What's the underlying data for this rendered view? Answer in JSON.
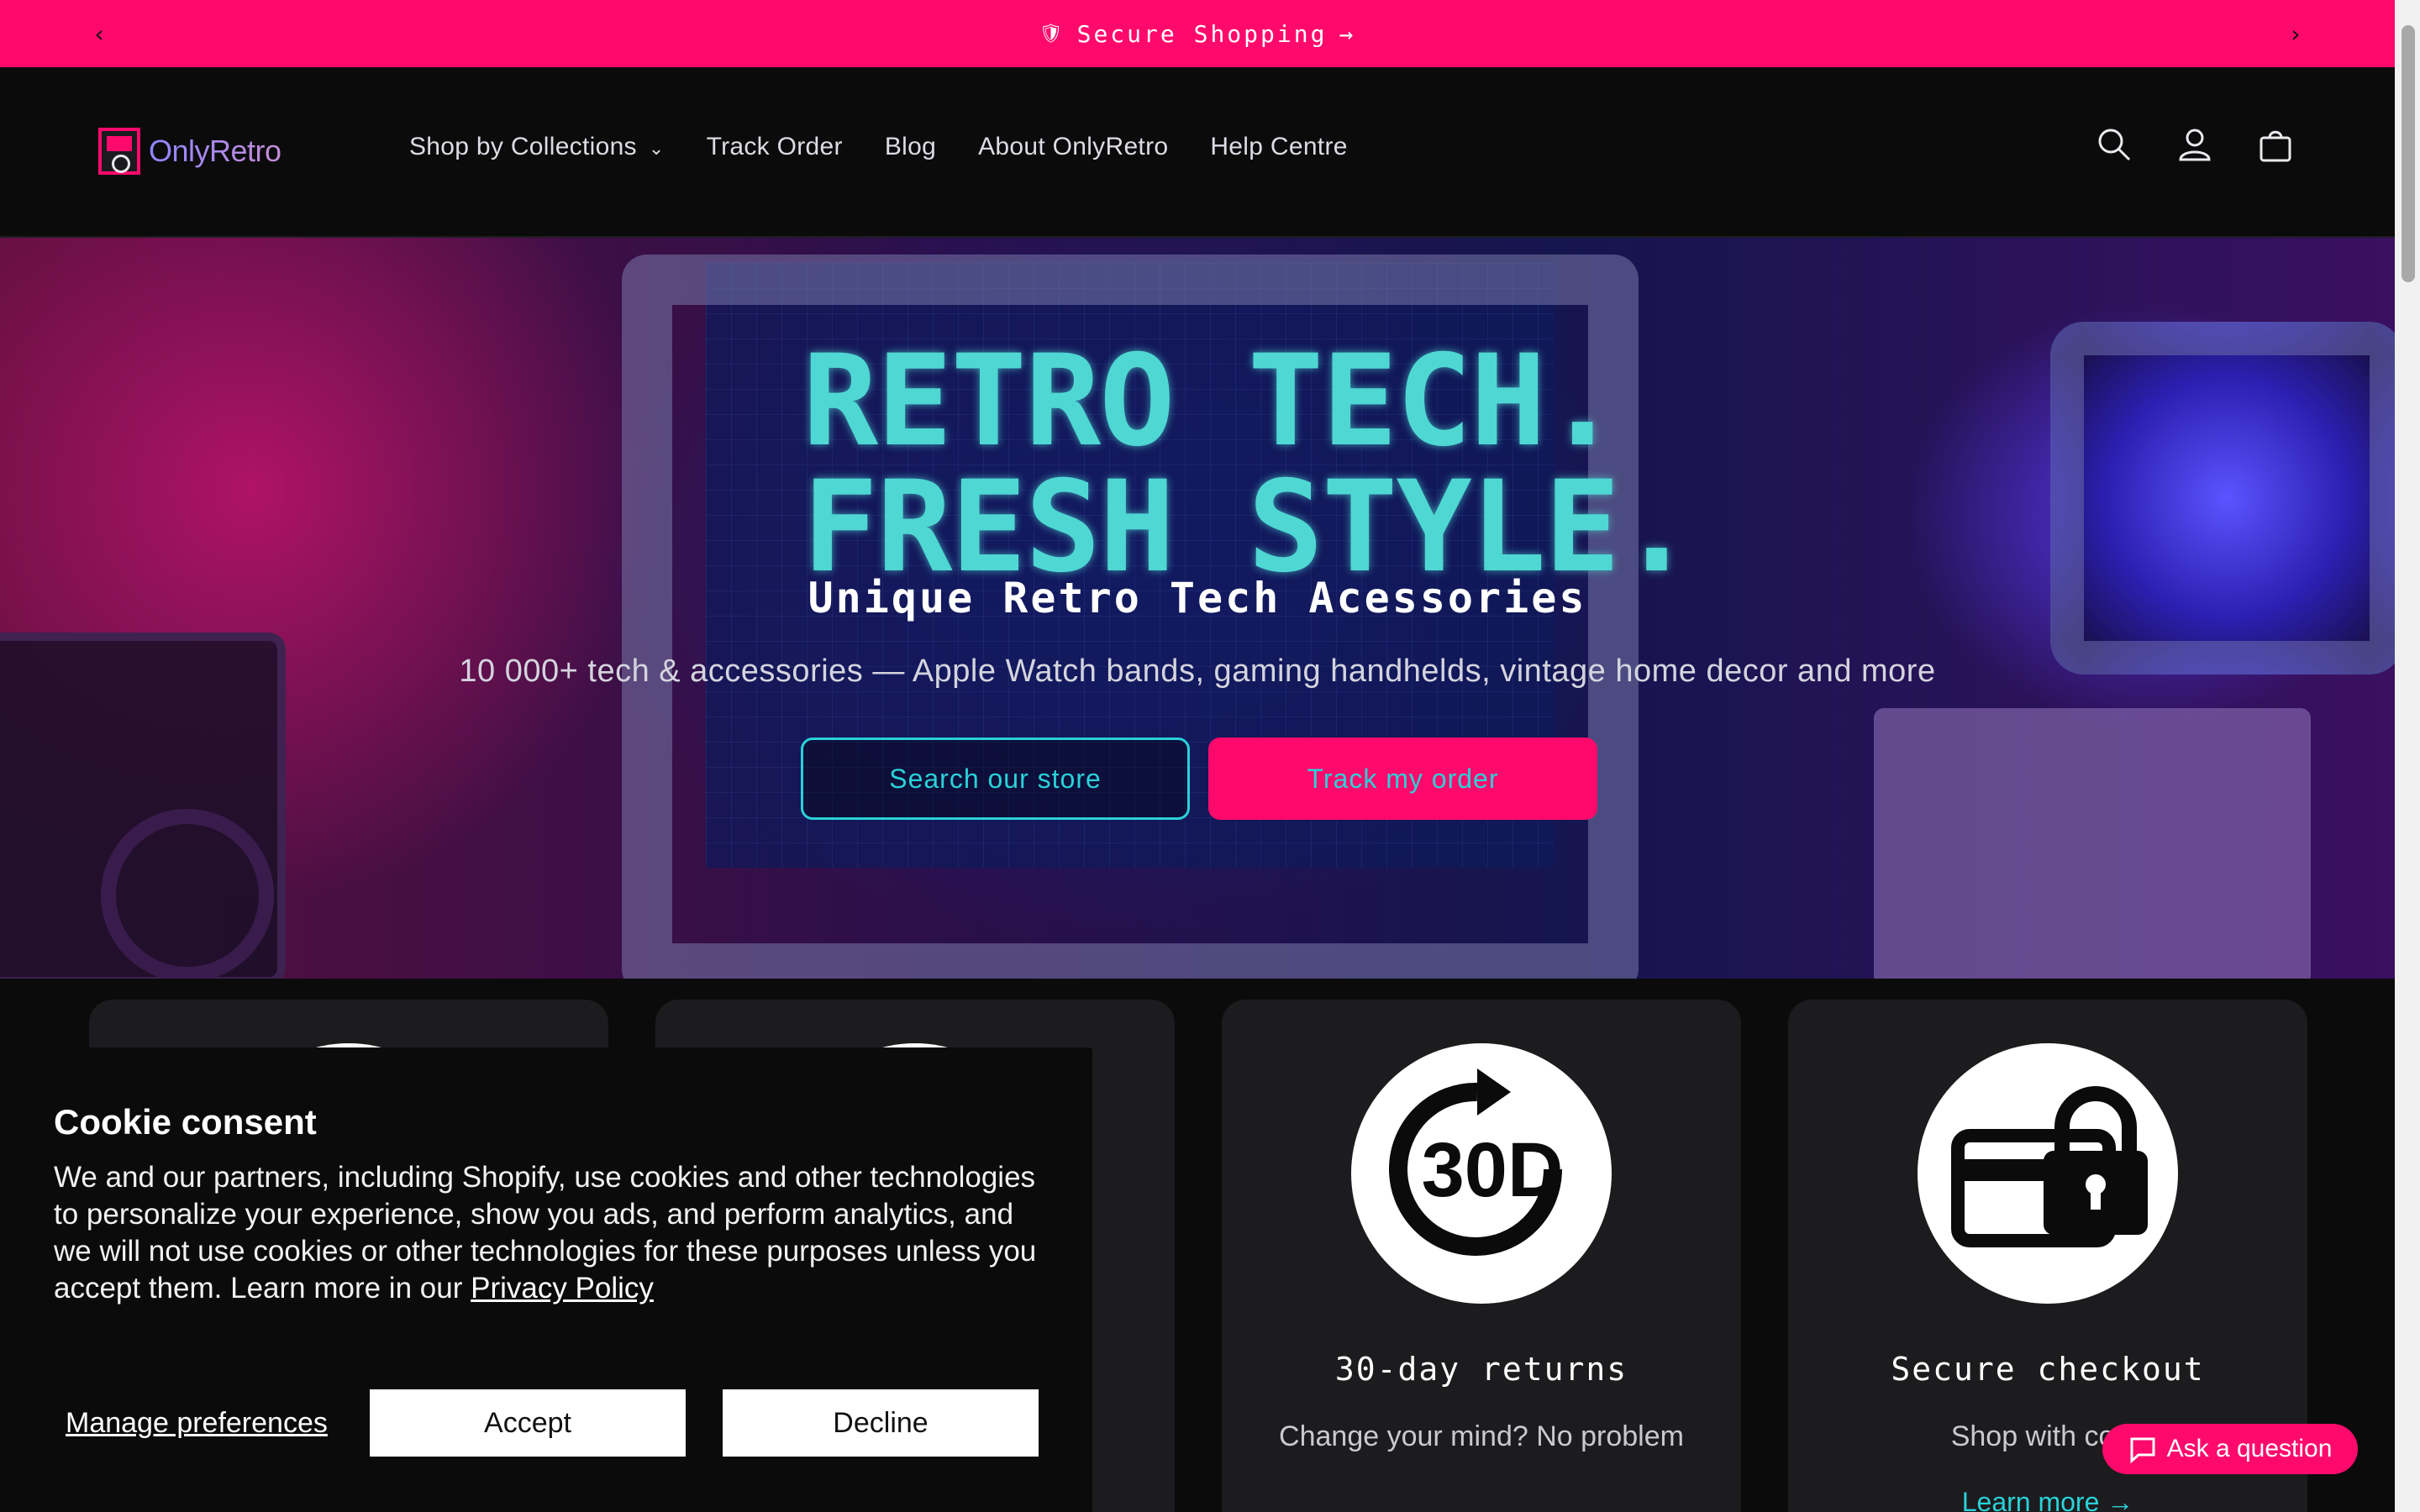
{
  "announcement": {
    "text": "Secure Shopping",
    "arrow": "→",
    "prev_icon": "‹",
    "next_icon": "›",
    "shield_icon": "🛡"
  },
  "header": {
    "logo_text": "OnlyRetro",
    "nav": [
      {
        "label": "Shop by Collections",
        "has_dropdown": true
      },
      {
        "label": "Track Order"
      },
      {
        "label": "Blog"
      },
      {
        "label": "About OnlyRetro"
      },
      {
        "label": "Help Centre"
      }
    ],
    "dropdown_icon": "⌄",
    "icons": [
      "search-icon",
      "account-icon",
      "cart-icon"
    ]
  },
  "hero": {
    "image_text_line1": "RETRO TECH.",
    "image_text_line2": "FRESH STYLE.",
    "title": "Unique Retro Tech Acessories",
    "subtitle": "10 000+ tech & accessories — Apple Watch bands, gaming handhelds, vintage home decor and more",
    "btn_search": "Search our store",
    "btn_track": "Track my order"
  },
  "cards": [
    {
      "title": "30-day returns",
      "text": "Change your mind? No problem",
      "icon_label": "30D"
    },
    {
      "title": "Secure checkout",
      "text": "Shop with confi",
      "link": "Learn more →"
    }
  ],
  "cookie": {
    "title": "Cookie consent",
    "body": "We and our partners, including Shopify, use cookies and other technologies to personalize your experience, show you ads, and perform analytics, and we will not use cookies or other technologies for these purposes unless you accept them. Learn more in our ",
    "policy_link": "Privacy Policy",
    "manage": "Manage preferences",
    "accept": "Accept",
    "decline": "Decline"
  },
  "chat": {
    "label": "Ask a question"
  },
  "colors": {
    "accent": "#ff0a6c",
    "teal": "#2ad1d8",
    "background": "#0b0b0c",
    "card": "#1c1c1e"
  }
}
